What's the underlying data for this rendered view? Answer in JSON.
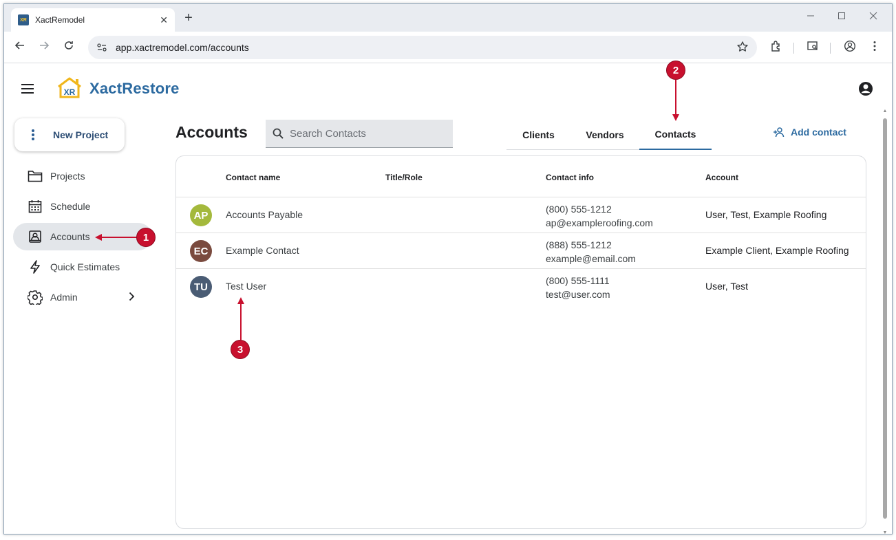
{
  "browser": {
    "tab_title": "XactRemodel",
    "favicon_text": "XR",
    "new_tab_symbol": "+",
    "tab_close_symbol": "✕",
    "url": "app.xactremodel.com/accounts"
  },
  "app": {
    "brand_name": "XactRestore",
    "logo_text": "XR",
    "new_project_label": "New Project",
    "nav": [
      {
        "label": "Projects",
        "icon": "folder-icon"
      },
      {
        "label": "Schedule",
        "icon": "calendar-icon"
      },
      {
        "label": "Accounts",
        "icon": "contact-card-icon",
        "active": true
      },
      {
        "label": "Quick Estimates",
        "icon": "lightning-icon"
      },
      {
        "label": "Admin",
        "icon": "gear-icon",
        "has_submenu": true
      }
    ]
  },
  "page": {
    "title": "Accounts",
    "search_placeholder": "Search Contacts",
    "tabs": [
      {
        "label": "Clients"
      },
      {
        "label": "Vendors"
      },
      {
        "label": "Contacts",
        "active": true
      }
    ],
    "add_contact_label": "Add contact"
  },
  "table": {
    "headers": {
      "name": "Contact name",
      "title": "Title/Role",
      "info": "Contact info",
      "account": "Account"
    },
    "rows": [
      {
        "initials": "AP",
        "avatar_color": "#a4b93c",
        "name": "Accounts Payable",
        "title": "",
        "phone": "(800) 555-1212",
        "email": "ap@exampleroofing.com",
        "account": "User, Test, Example Roofing"
      },
      {
        "initials": "EC",
        "avatar_color": "#7a4a3e",
        "name": "Example Contact",
        "title": "",
        "phone": "(888) 555-1212",
        "email": "example@email.com",
        "account": "Example Client, Example Roofing"
      },
      {
        "initials": "TU",
        "avatar_color": "#4a5c74",
        "name": "Test User",
        "title": "",
        "phone": "(800) 555-1111",
        "email": "test@user.com",
        "account": "User, Test"
      }
    ]
  },
  "annotations": {
    "one": "1",
    "two": "2",
    "three": "3",
    "color": "#c8102e"
  }
}
